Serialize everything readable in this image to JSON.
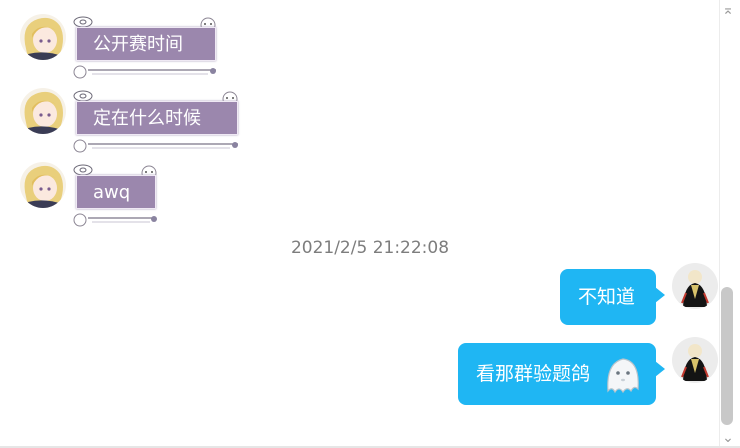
{
  "incoming": [
    {
      "text": "公开赛时间"
    },
    {
      "text": "定在什么时候"
    },
    {
      "text": "awq"
    }
  ],
  "timestamp": "2021/2/5 21:22:08",
  "outgoing": [
    {
      "text": "不知道"
    },
    {
      "text": "看那群验题鸽",
      "emoji": "ghost-emoji"
    }
  ],
  "colors": {
    "incoming_bubble": "#9b87ad",
    "outgoing_bubble": "#1fb6f3",
    "timestamp_text": "#7d7d7d"
  }
}
